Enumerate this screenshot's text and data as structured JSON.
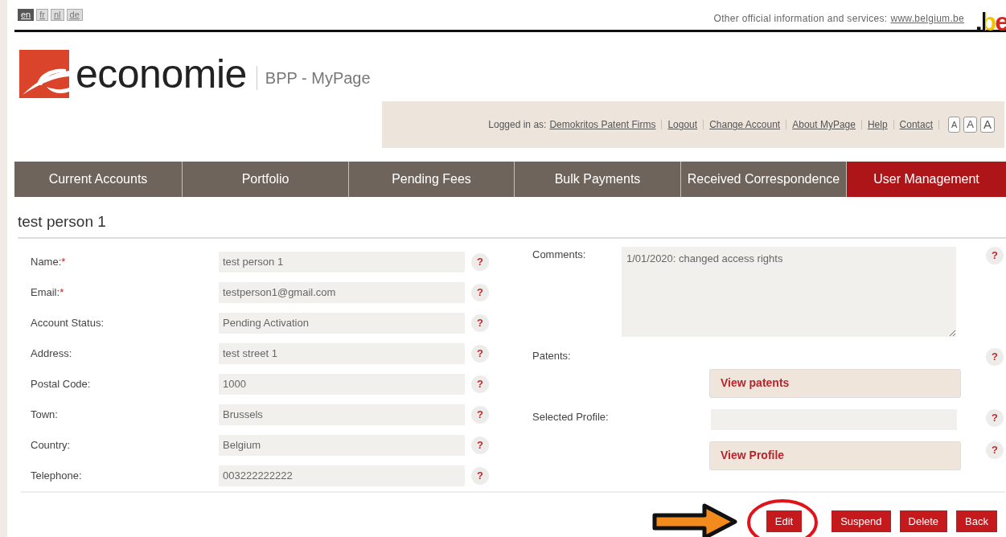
{
  "languages": [
    {
      "label": "en",
      "selected": true
    },
    {
      "label": "fr",
      "selected": false
    },
    {
      "label": "nl",
      "selected": false
    },
    {
      "label": "de",
      "selected": false
    }
  ],
  "top_links": {
    "text": "Other official information and services:",
    "link": "www.belgium.be",
    "logo": ".be"
  },
  "brand": {
    "name": "economie",
    "app": "BPP - MyPage"
  },
  "login_bar": {
    "prefix": "Logged in as:",
    "user": "Demokritos Patent Firms",
    "links": [
      "Logout",
      "Change Account",
      "About MyPage",
      "Help",
      "Contact"
    ],
    "font_sizes": [
      "A",
      "A",
      "A"
    ]
  },
  "tabs": [
    {
      "label": "Current Accounts",
      "selected": false
    },
    {
      "label": "Portfolio",
      "selected": false
    },
    {
      "label": "Pending Fees",
      "selected": false
    },
    {
      "label": "Bulk Payments",
      "selected": false
    },
    {
      "label": "Received Correspondence",
      "selected": false
    },
    {
      "label": "User Management",
      "selected": true
    }
  ],
  "heading": "test person 1",
  "left_fields": [
    {
      "label": "Name:",
      "required_mark": "*",
      "value": "test person 1",
      "help": "?"
    },
    {
      "label": "Email:",
      "required_mark": "*",
      "value": "testperson1@gmail.com",
      "help": "?"
    },
    {
      "label": "Account Status:",
      "value": "Pending Activation",
      "help": "?"
    },
    {
      "label": "Address:",
      "value": "test street 1",
      "help": "?"
    },
    {
      "label": "Postal Code:",
      "value": "1000",
      "help": "?"
    },
    {
      "label": "Town:",
      "value": "Brussels",
      "help": "?"
    },
    {
      "label": "Country:",
      "value": "Belgium",
      "help": "?"
    },
    {
      "label": "Telephone:",
      "value": "003222222222",
      "help": "?"
    }
  ],
  "right_fields": [
    {
      "kind": "textarea",
      "label": "Comments:",
      "value": "1/01/2020: changed access rights",
      "help": "?"
    },
    {
      "kind": "label",
      "label": "Patents:",
      "help": "?"
    },
    {
      "kind": "button",
      "text": "View patents"
    },
    {
      "kind": "field",
      "label": "Selected Profile:",
      "help": "?"
    },
    {
      "kind": "button",
      "text": "View Profile",
      "help": "?"
    }
  ],
  "annotations": [
    {
      "kind": "arrow"
    },
    {
      "kind": "circle"
    }
  ],
  "actions": [
    {
      "label": "Edit"
    },
    {
      "label": "Suspend"
    },
    {
      "label": "Delete"
    },
    {
      "label": "Back"
    }
  ]
}
